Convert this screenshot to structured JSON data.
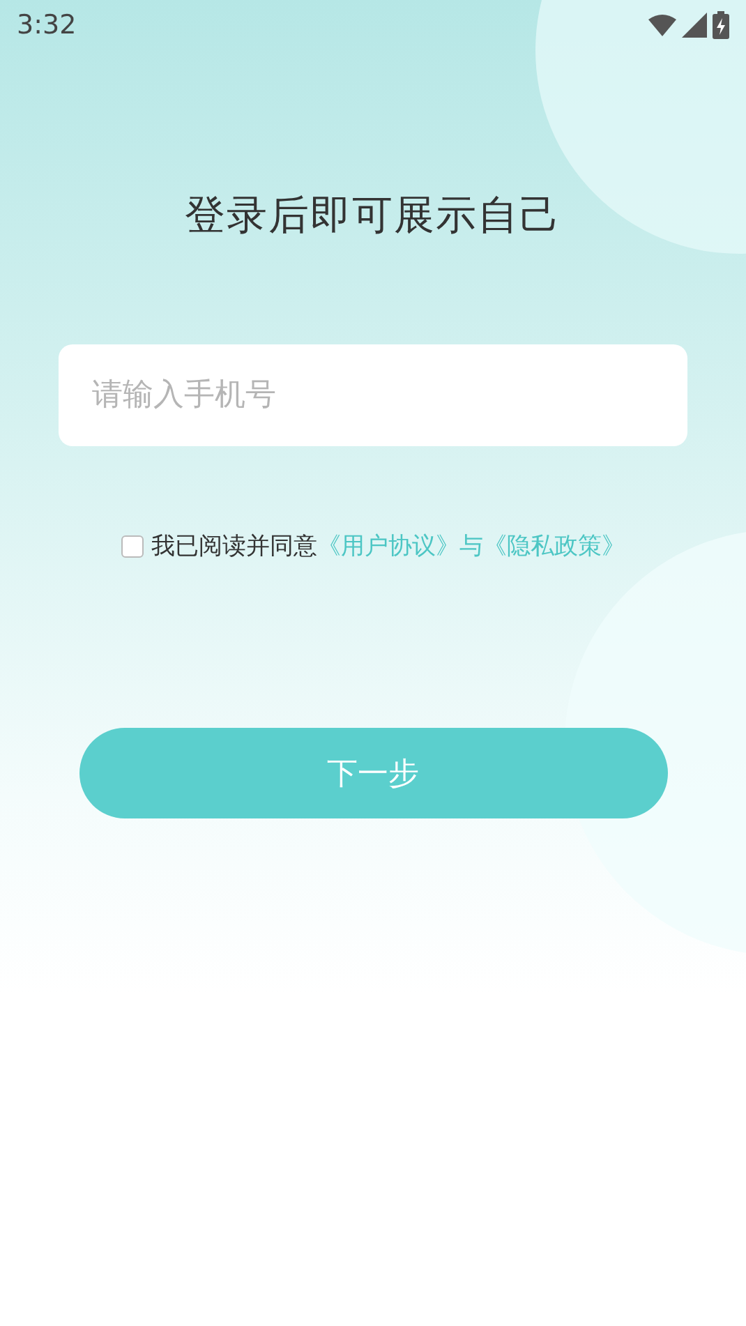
{
  "status_bar": {
    "time": "3:32"
  },
  "title": "登录后即可展示自己",
  "phone_field": {
    "placeholder": "请输入手机号"
  },
  "agreement": {
    "checked": false,
    "text": "我已阅读并同意",
    "user_agreement_link": "《用户协议》",
    "joiner": "与",
    "privacy_policy_link": "《隐私政策》"
  },
  "next_button": {
    "label": "下一步"
  }
}
